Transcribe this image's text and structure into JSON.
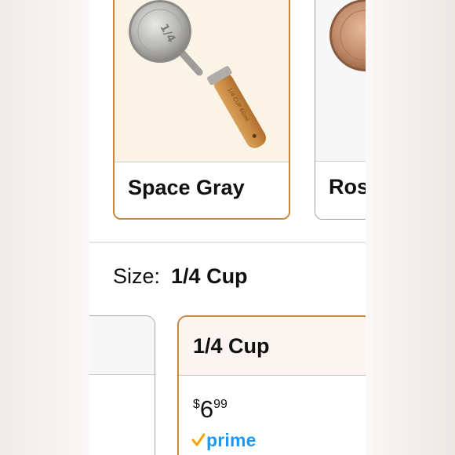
{
  "swatches": [
    {
      "label": "Space Gray",
      "state": "selected",
      "image_icon": "measuring-cup-wood-handle"
    },
    {
      "label": "Ros",
      "state": "unselected",
      "image_icon": "rose-gold-measuring-cup"
    }
  ],
  "size": {
    "key": "Size:",
    "value": "1/4 Cup"
  },
  "size_options": [
    {
      "label": "1/4 Cup",
      "price_symbol": "$",
      "price_whole": "6",
      "price_fraction": "99",
      "badge": "prime"
    }
  ],
  "colors": {
    "accent": "#c8873a",
    "prime": "#1a98ff",
    "prime_check": "#f5a300",
    "text": "#0f1111"
  }
}
